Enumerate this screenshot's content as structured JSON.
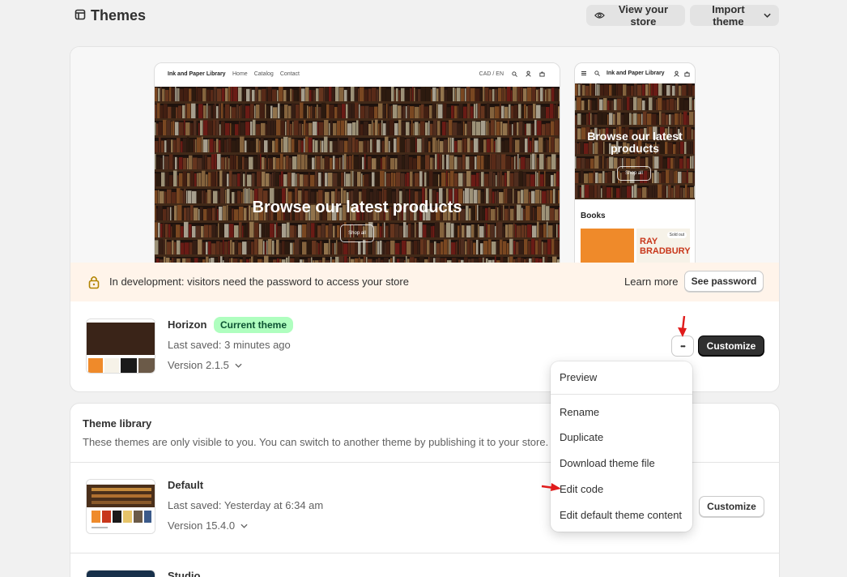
{
  "header": {
    "title": "Themes",
    "view_store": "View your store",
    "import_theme": "Import theme"
  },
  "preview": {
    "desktop": {
      "brand": "Ink and Paper Library",
      "nav": [
        "Home",
        "Catalog",
        "Contact"
      ],
      "locale": "CAD / EN",
      "hero_title": "Browse our latest products",
      "shop_all": "Shop all"
    },
    "mobile": {
      "brand": "Ink and Paper Library",
      "hero_title": "Browse our latest products",
      "shop_all": "Shop all",
      "section_title": "Books",
      "book_title": "RAY BRADBURY",
      "sold_out": "Sold out"
    }
  },
  "banner": {
    "text": "In development: visitors need the password to access your store",
    "learn_more": "Learn more",
    "see_password": "See password"
  },
  "current_theme": {
    "name": "Horizon",
    "badge": "Current theme",
    "saved": "Last saved: 3 minutes ago",
    "version": "Version 2.1.5",
    "more": "•••",
    "customize": "Customize"
  },
  "library": {
    "title": "Theme library",
    "description": "These themes are only visible to you. You can switch to another theme by publishing it to your store.",
    "themes": [
      {
        "name": "Default",
        "saved": "Last saved: Yesterday at 6:34 am",
        "version": "Version 15.4.0",
        "customize": "Customize"
      },
      {
        "name": "Studio"
      }
    ]
  },
  "menu": {
    "items": [
      "Preview",
      "Rename",
      "Duplicate",
      "Download theme file",
      "Edit code",
      "Edit default theme content"
    ]
  },
  "colors": {
    "background": "#f1f1f1",
    "badge_bg": "#affebf",
    "badge_text": "#0c5132",
    "banner_bg": "#fff4ea",
    "primary_button": "#303030",
    "annotation_arrow": "#e01b1b"
  }
}
